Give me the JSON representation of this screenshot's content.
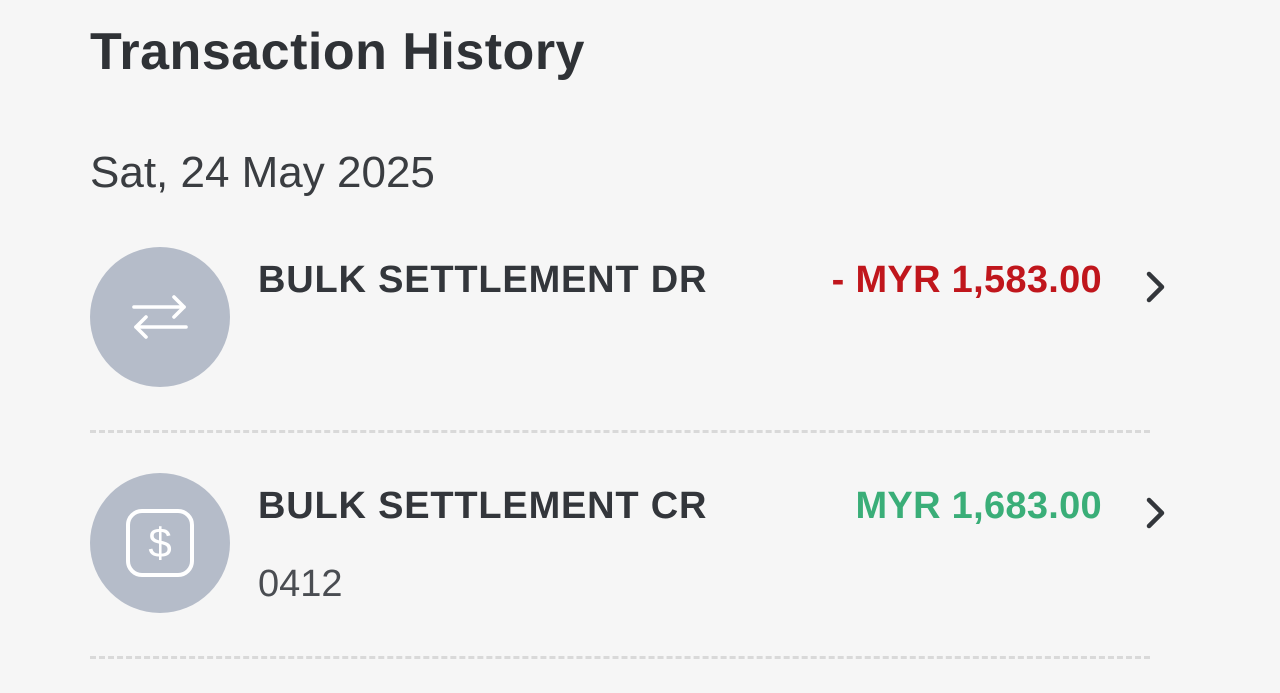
{
  "page": {
    "title": "Transaction History"
  },
  "groups": [
    {
      "date": "Sat, 24 May 2025",
      "transactions": [
        {
          "icon": "transfer-arrows-icon",
          "name": "BULK SETTLEMENT DR",
          "amount": "- MYR 1,583.00",
          "amount_color": "#c0161c",
          "detail": ""
        },
        {
          "icon": "dollar-square-icon",
          "name": "BULK SETTLEMENT CR",
          "amount": "MYR 1,683.00",
          "amount_color": "#3aae78",
          "detail": "0412"
        }
      ]
    }
  ],
  "colors": {
    "background": "#f6f6f6",
    "avatar": "#b5bcc9",
    "debit": "#c0161c",
    "credit": "#3aae78",
    "text": "#33363b",
    "divider": "#d9d9d9"
  }
}
